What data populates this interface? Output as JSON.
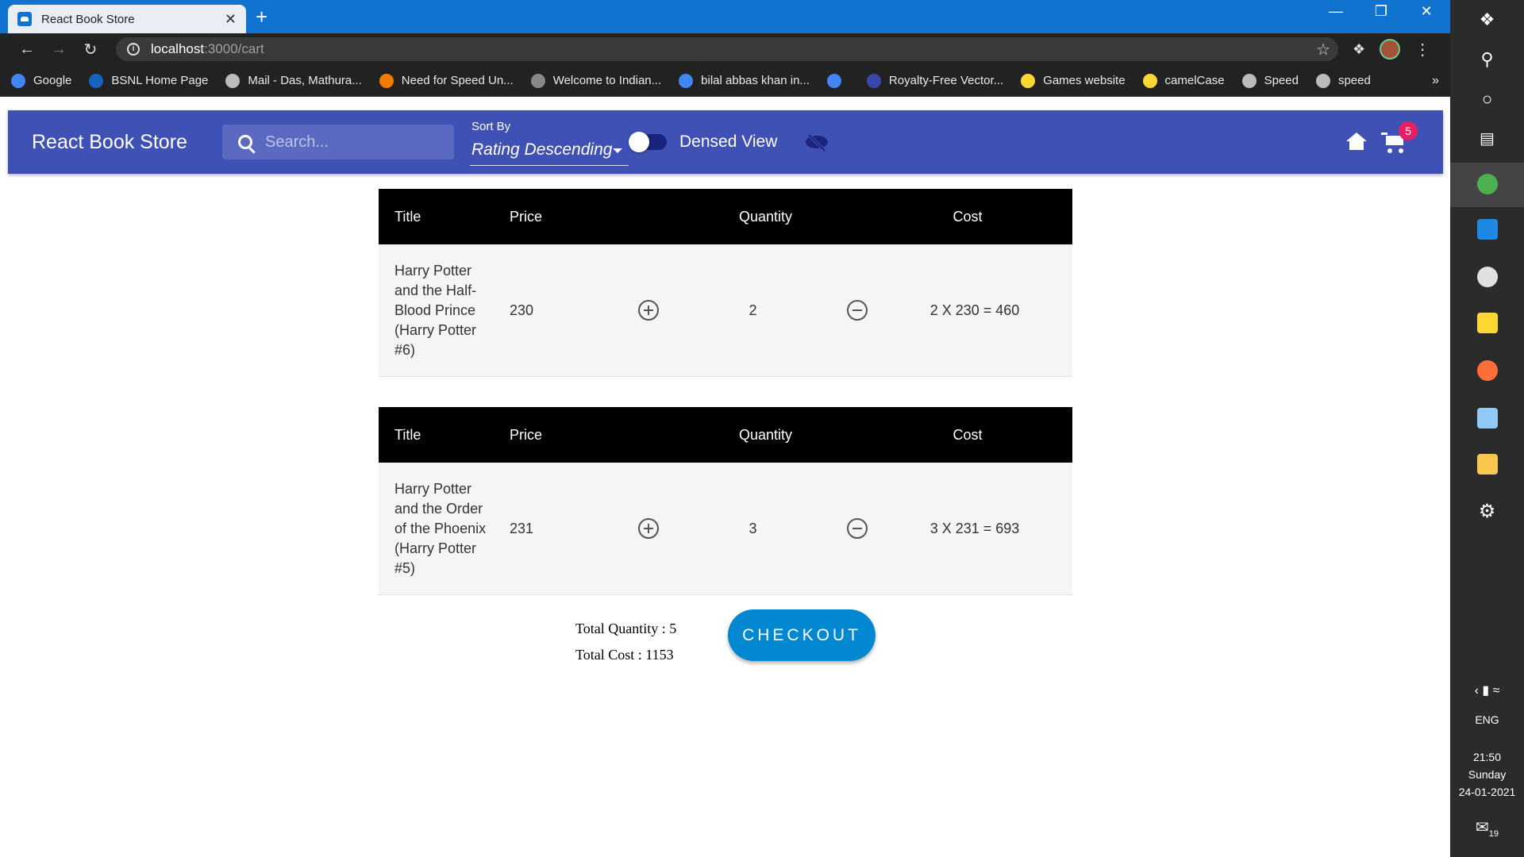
{
  "browser": {
    "tab_title": "React Book Store",
    "tab_close": "✕",
    "new_tab": "+",
    "url_host": "localhost",
    "url_path": ":3000/cart",
    "bookmarks": [
      {
        "label": "Google",
        "color": "#4285f4"
      },
      {
        "label": "BSNL Home Page",
        "color": "#1565c0"
      },
      {
        "label": "Mail - Das, Mathura...",
        "color": "#bbbbbb"
      },
      {
        "label": "Need for Speed Un...",
        "color": "#f57c00"
      },
      {
        "label": "Welcome to Indian...",
        "color": "#888888"
      },
      {
        "label": "bilal abbas khan in...",
        "color": "#4285f4"
      },
      {
        "label": "",
        "color": "#4285f4"
      },
      {
        "label": "Royalty-Free Vector...",
        "color": "#3949ab"
      },
      {
        "label": "Games website",
        "color": "#fdd835"
      },
      {
        "label": "camelCase",
        "color": "#fdd835"
      },
      {
        "label": "Speed",
        "color": "#bbbbbb"
      },
      {
        "label": "speed",
        "color": "#bbbbbb"
      }
    ],
    "bookmarks_more": "»"
  },
  "appbar": {
    "brand": "React Book Store",
    "search_placeholder": "Search...",
    "sort_label": "Sort By",
    "sort_value": "Rating Descending",
    "dense_label": "Densed View",
    "cart_count": "5",
    "color": "#3f51b5"
  },
  "cart": {
    "headers": {
      "title": "Title",
      "price": "Price",
      "quantity": "Quantity",
      "cost": "Cost"
    },
    "items": [
      {
        "title_lines": [
          "Harry Potter",
          "and the Half-",
          "Blood Prince",
          "(Harry Potter",
          "#6)"
        ],
        "price": "230",
        "quantity": "2",
        "cost": "2 X 230 = 460"
      },
      {
        "title_lines": [
          "Harry Potter",
          "and the Order",
          "of the Phoenix",
          "(Harry Potter",
          "#5)"
        ],
        "price": "231",
        "quantity": "3",
        "cost": "3 X 231 = 693"
      }
    ],
    "total_quantity": "Total Quantity : 5",
    "total_cost": "Total Cost : 1153",
    "checkout": "CHECKOUT"
  },
  "taskbar": {
    "lang": "ENG",
    "time": "21:50",
    "day": "Sunday",
    "date": "24-01-2021",
    "notifications": "19"
  }
}
